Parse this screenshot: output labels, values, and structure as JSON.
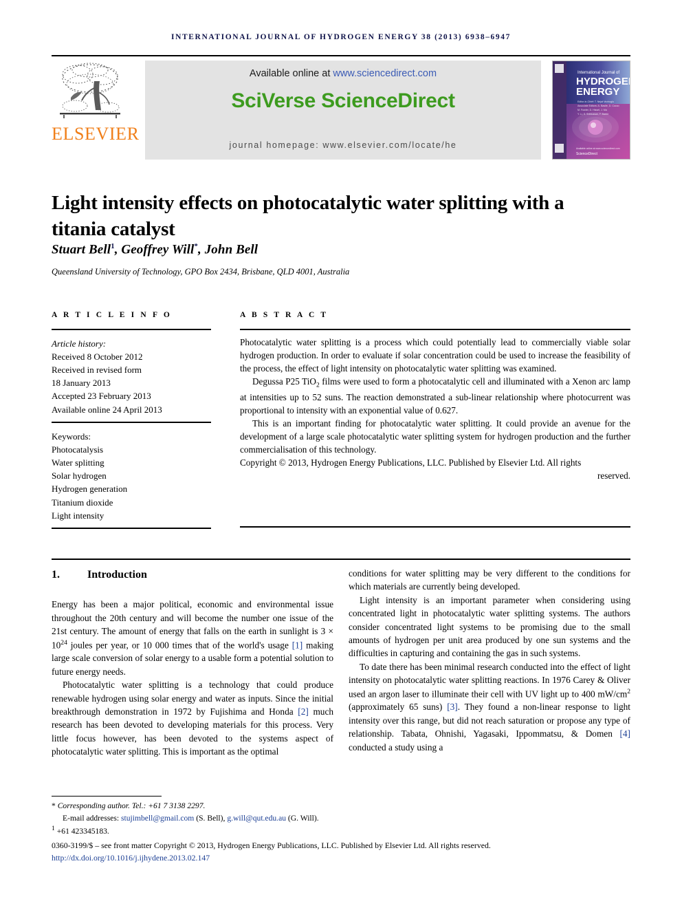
{
  "running_head": "International Journal of Hydrogen Energy 38 (2013) 6938–6947",
  "masthead": {
    "publisher": "ELSEVIER",
    "available_prefix": "Available online at ",
    "available_url": "www.sciencedirect.com",
    "brand": "SciVerse ScienceDirect",
    "homepage": "journal homepage: www.elsevier.com/locate/he",
    "cover": {
      "line1": "International Journal of",
      "line2": "HYDROGEN",
      "line3": "ENERGY",
      "editors": "Editor-in-Chief: T. Nejat Veziroglu",
      "footer": "ScienceDirect"
    },
    "colors": {
      "elsevier_orange": "#f07f1a",
      "sciverse_green": "#3d9b1f",
      "link_blue": "#3b5bb5",
      "box_gray": "#e3e3e3"
    }
  },
  "article": {
    "title": "Light intensity effects on photocatalytic water splitting with a titania catalyst",
    "authors": "Stuart Bell, Geoffrey Will, John Bell",
    "author_list": [
      {
        "name": "Stuart Bell",
        "marker": "1"
      },
      {
        "name": "Geoffrey Will",
        "marker": "*"
      },
      {
        "name": "John Bell",
        "marker": ""
      }
    ],
    "affiliation": "Queensland University of Technology, GPO Box 2434, Brisbane, QLD 4001, Australia"
  },
  "info": {
    "label": "A R T I C L E   I N F O",
    "history_label": "Article history:",
    "history": [
      "Received 8 October 2012",
      "Received in revised form",
      "18 January 2013",
      "Accepted 23 February 2013",
      "Available online 24 April 2013"
    ],
    "keywords_label": "Keywords:",
    "keywords": [
      "Photocatalysis",
      "Water splitting",
      "Solar hydrogen",
      "Hydrogen generation",
      "Titanium dioxide",
      "Light intensity"
    ]
  },
  "abstract": {
    "label": "A B S T R A C T",
    "paragraph1": "Photocatalytic water splitting is a process which could potentially lead to commercially viable solar hydrogen production. In order to evaluate if solar concentration could be used to increase the feasibility of the process, the effect of light intensity on photocatalytic water splitting was examined.",
    "paragraph2_a": "Degussa P25 TiO",
    "paragraph2_sub": "2",
    "paragraph2_b": " films were used to form a photocatalytic cell and illuminated with a Xenon arc lamp at intensities up to 52 suns. The reaction demonstrated a sub-linear relationship where photocurrent was proportional to intensity with an exponential value of 0.627.",
    "paragraph3": "This is an important finding for photocatalytic water splitting. It could provide an avenue for the development of a large scale photocatalytic water splitting system for hydrogen production and the further commercialisation of this technology.",
    "copyright_main": "Copyright © 2013, Hydrogen Energy Publications, LLC. Published by Elsevier Ltd. All rights",
    "copyright_tail": "reserved."
  },
  "section": {
    "number": "1.",
    "heading": "Introduction"
  },
  "body": {
    "left": {
      "p1_a": "Energy has been a major political, economic and environmental issue throughout the 20th century and will become the number one issue of the 21st century. The amount of energy that falls on the earth in sunlight is 3 × 10",
      "p1_exp": "24",
      "p1_b": " joules per year, or 10 000 times that of the world's usage ",
      "p1_ref": "[1]",
      "p1_c": " making large scale conversion of solar energy to a usable form a potential solution to future energy needs.",
      "p2_a": "Photocatalytic water splitting is a technology that could produce renewable hydrogen using solar energy and water as inputs. Since the initial breakthrough demonstration in 1972 by Fujishima and Honda ",
      "p2_ref": "[2]",
      "p2_b": " much research has been devoted to developing materials for this process. Very little focus however, has been devoted to the systems aspect of photocatalytic water splitting. This is important as the optimal"
    },
    "right": {
      "p1": "conditions for water splitting may be very different to the conditions for which materials are currently being developed.",
      "p2": "Light intensity is an important parameter when considering using concentrated light in photocatalytic water splitting systems. The authors consider concentrated light systems to be promising due to the small amounts of hydrogen per unit area produced by one sun systems and the difficulties in capturing and containing the gas in such systems.",
      "p3_a": "To date there has been minimal research conducted into the effect of light intensity on photocatalytic water splitting reactions. In 1976 Carey & Oliver used an argon laser to illuminate their cell with UV light up to 400 mW/cm",
      "p3_exp": "2",
      "p3_b": " (approximately 65 suns) ",
      "p3_ref1": "[3]",
      "p3_c": ". They found a non-linear response to light intensity over this range, but did not reach saturation or propose any type of relationship. Tabata, Ohnishi, Yagasaki, Ippommatsu, & Domen ",
      "p3_ref2": "[4]",
      "p3_d": " conducted a study using a"
    }
  },
  "footnotes": {
    "corresponding": "Corresponding author. Tel.: +61 7 3138 2297.",
    "email_label": "E-mail addresses: ",
    "email1": "stujimbell@gmail.com",
    "email1_owner": " (S. Bell), ",
    "email2": "g.will@qut.edu.au",
    "email2_owner": " (G. Will).",
    "note1_marker": "1",
    "note1": "+61 423345183.",
    "imprint": "0360-3199/$ – see front matter Copyright © 2013, Hydrogen Energy Publications, LLC. Published by Elsevier Ltd. All rights reserved.",
    "doi": "http://dx.doi.org/10.1016/j.ijhydene.2013.02.147"
  }
}
